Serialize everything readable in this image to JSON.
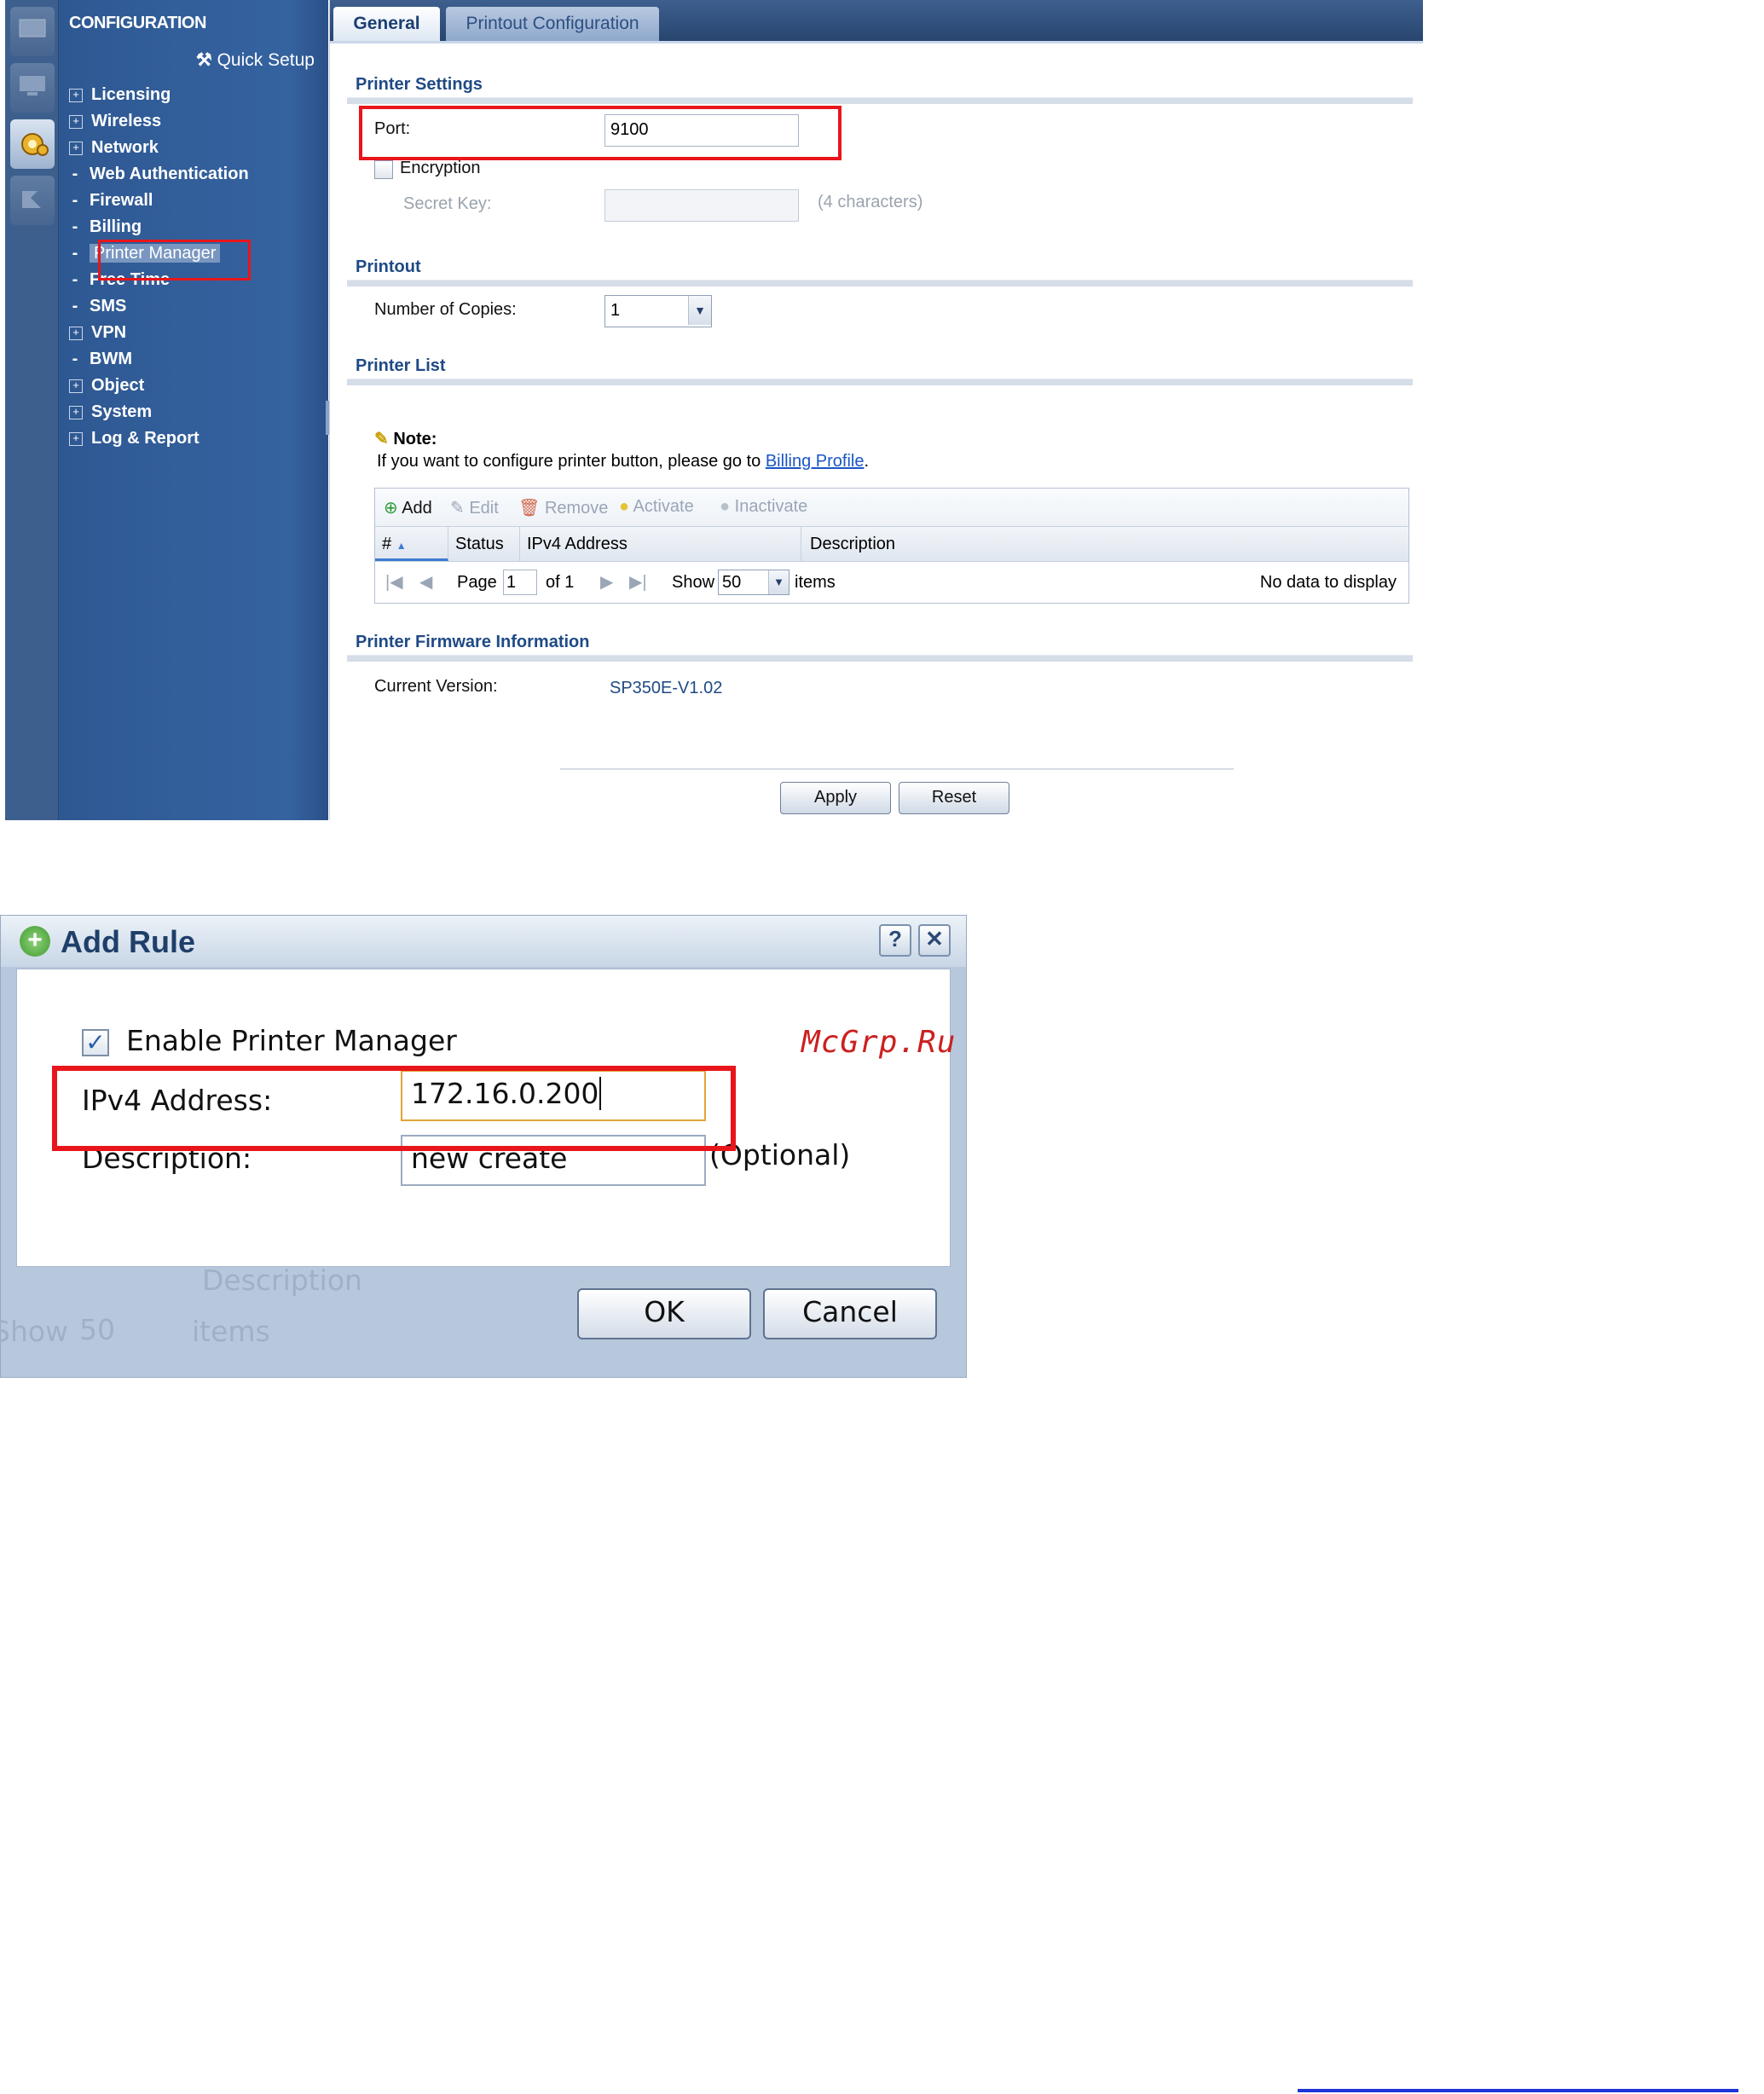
{
  "nav": {
    "title": "CONFIGURATION",
    "quick_setup": "Quick Setup",
    "items": [
      {
        "label": "Licensing",
        "expandable": true
      },
      {
        "label": "Wireless",
        "expandable": true
      },
      {
        "label": "Network",
        "expandable": true
      },
      {
        "label": "Web Authentication",
        "expandable": false
      },
      {
        "label": "Firewall",
        "expandable": false
      },
      {
        "label": "Billing",
        "expandable": false
      },
      {
        "label": "Printer Manager",
        "expandable": false,
        "selected": true
      },
      {
        "label": "Free Time",
        "expandable": false
      },
      {
        "label": "SMS",
        "expandable": false
      },
      {
        "label": "VPN",
        "expandable": true
      },
      {
        "label": "BWM",
        "expandable": false
      },
      {
        "label": "Object",
        "expandable": true
      },
      {
        "label": "System",
        "expandable": true
      },
      {
        "label": "Log & Report",
        "expandable": true
      }
    ]
  },
  "tabs": {
    "general": "General",
    "printout": "Printout Configuration"
  },
  "printer_settings": {
    "title": "Printer Settings",
    "port_label": "Port:",
    "port_value": "9100",
    "encryption_label": "Encryption",
    "secret_key_label": "Secret Key:",
    "secret_key_hint": "(4 characters)"
  },
  "printout": {
    "title": "Printout",
    "copies_label": "Number of Copies:",
    "copies_value": "1"
  },
  "printer_list": {
    "title": "Printer List",
    "note_title": "Note:",
    "note_text": "If you want to configure printer button, please go to ",
    "note_link": "Billing Profile",
    "note_end": ".",
    "toolbar": {
      "add": "Add",
      "edit": "Edit",
      "remove": "Remove",
      "activate": "Activate",
      "inactivate": "Inactivate"
    },
    "columns": {
      "num": "#",
      "status": "Status",
      "ipv4": "IPv4 Address",
      "description": "Description"
    },
    "pager": {
      "page": "Page",
      "page_value": "1",
      "of": "of 1",
      "show": "Show",
      "show_value": "50",
      "items": "items",
      "empty": "No data to display"
    }
  },
  "firmware": {
    "title": "Printer Firmware Information",
    "current_label": "Current Version:",
    "current_value": "SP350E-V1.02"
  },
  "actions": {
    "apply": "Apply",
    "reset": "Reset"
  },
  "dialog": {
    "title": "Add Rule",
    "help": "?",
    "close": "✕",
    "enable_label": "Enable Printer Manager",
    "enable_checked": true,
    "ipv4_label": "IPv4 Address:",
    "ipv4_value": "172.16.0.200",
    "desc_label": "Description:",
    "desc_value": "new create",
    "desc_hint": "(Optional)",
    "ok": "OK",
    "cancel": "Cancel",
    "bg_description": "Description",
    "bg_show": "Show",
    "bg_show_value": "50",
    "bg_items": "items"
  },
  "watermark": "McGrp.Ru",
  "colors": {
    "highlight_red": "#e8151b",
    "nav_blue": "#2f5a93",
    "section_blue": "#1f4a85",
    "link_blue": "#1a56c7"
  }
}
